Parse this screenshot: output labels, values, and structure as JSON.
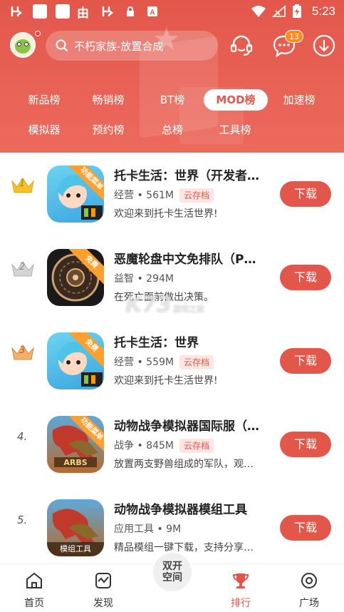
{
  "status_bar": {
    "time": "5:23"
  },
  "search": {
    "placeholder": "不朽家族-放置合成"
  },
  "header": {
    "message_badge": "13"
  },
  "tabs": [
    {
      "label": "新品榜",
      "active": false
    },
    {
      "label": "畅销榜",
      "active": false
    },
    {
      "label": "BT榜",
      "active": false
    },
    {
      "label": "MOD榜",
      "active": true
    },
    {
      "label": "加速榜",
      "active": false
    },
    {
      "label": "模拟器",
      "active": false
    },
    {
      "label": "预约榜",
      "active": false
    },
    {
      "label": "总榜",
      "active": false
    },
    {
      "label": "工具榜",
      "active": false
    }
  ],
  "apps": [
    {
      "rank": "1",
      "title": "托卡生活：世界（开发者…",
      "category": "经营",
      "size": "561M",
      "tag": "云存档",
      "desc": "欢迎来到托卡生活世界!",
      "ribbon": "功能菜单",
      "button": "下载"
    },
    {
      "rank": "2",
      "title": "恶魔轮盘中文免排队（P…",
      "category": "益智",
      "size": "294M",
      "tag": "",
      "desc": "在死亡面前做出决策。",
      "ribbon": "免费",
      "button": "下载"
    },
    {
      "rank": "3",
      "title": "托卡生活：世界",
      "category": "经营",
      "size": "559M",
      "tag": "云存档",
      "desc": "欢迎来到托卡生活世界!",
      "ribbon": "免费",
      "button": "下载"
    },
    {
      "rank": "4.",
      "title": "动物战争模拟器国际服（…",
      "category": "战争",
      "size": "845M",
      "tag": "云存档",
      "desc": "放置两支野兽组成的军队，观…",
      "ribbon": "功能菜单",
      "button": "下载"
    },
    {
      "rank": "5.",
      "title": "动物战争模拟器模组工具",
      "category": "应用工具",
      "size": "9M",
      "tag": "",
      "desc": "精品模组一键下载，支持分享…",
      "ribbon": "",
      "bottom_label": "模组工具",
      "button": "下载"
    }
  ],
  "watermark": {
    "logo": "K73",
    "sub": "游戏之家"
  },
  "bottom_nav": {
    "home": "首页",
    "discover": "发现",
    "center": "双开\n空间",
    "rank": "排行",
    "plaza": "广场"
  },
  "colors": {
    "accent": "#e3574b",
    "gold": "#f5c02a",
    "silver": "#c8c8c8",
    "bronze": "#f0a35a"
  }
}
